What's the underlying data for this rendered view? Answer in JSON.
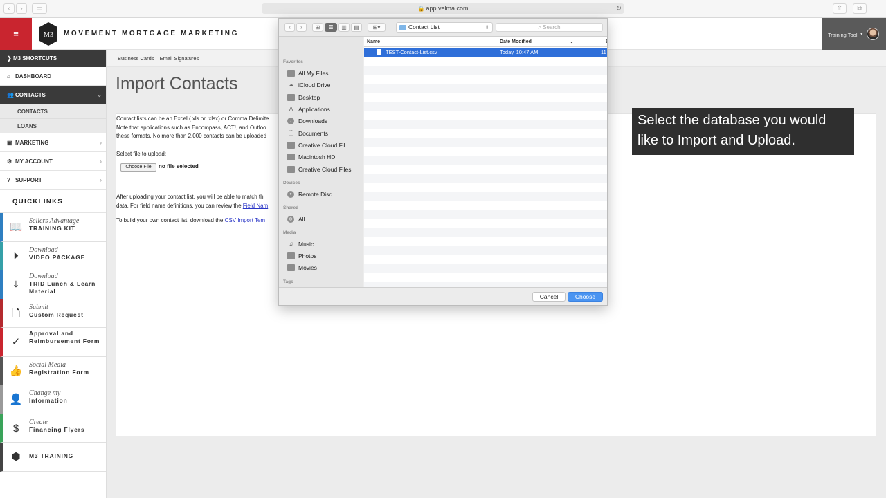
{
  "browser": {
    "url": "app.velma.com",
    "back": "‹",
    "forward": "›"
  },
  "header": {
    "brand": "MOVEMENT MORTGAGE MARKETING",
    "menu_icon": "hamburger-icon",
    "user_label": "Training Tool",
    "accent": "#c9252f"
  },
  "sidebar": {
    "shortcuts": "M3 SHORTCUTS",
    "nav": {
      "dashboard": "DASHBOARD",
      "contacts": "CONTACTS",
      "contacts_sub": "CONTACTS",
      "loans_sub": "LOANS",
      "marketing": "MARKETING",
      "my_account": "MY ACCOUNT",
      "support": "SUPPORT"
    },
    "quicklinks_title": "QUICKLINKS",
    "quicklinks": [
      {
        "italic": "Sellers Advantage",
        "bold": "TRAINING KIT",
        "color": "#2f7fc1",
        "icon": "book-icon"
      },
      {
        "italic": "Download",
        "bold": "VIDEO PACKAGE",
        "color": "#35a0a8",
        "icon": "play-icon"
      },
      {
        "italic": "Download",
        "bold": "TRID Lunch & Learn Material",
        "color": "#2f7fc1",
        "icon": "download-tray-icon"
      },
      {
        "italic": "Submit",
        "bold": "Custom Request",
        "color": "#b42a2f",
        "icon": "document-icon"
      },
      {
        "italic": "",
        "bold": "Approval and Reimbursement Form",
        "color": "#c9252f",
        "icon": "checkmark-icon"
      },
      {
        "italic": "Social Media",
        "bold": "Registration Form",
        "color": "#555555",
        "icon": "thumbs-up-icon"
      },
      {
        "italic": "Change my",
        "bold": "Information",
        "color": "#9a9a9a",
        "icon": "user-icon"
      },
      {
        "italic": "Create",
        "bold": "Financing Flyers",
        "color": "#3aa35a",
        "icon": "coin-stack-icon"
      },
      {
        "italic": "",
        "bold": "M3 TRAINING",
        "color": "#444444",
        "icon": "m3-logo-icon"
      }
    ]
  },
  "subnav": {
    "items": [
      "Business Cards",
      "Email Signatures"
    ]
  },
  "page": {
    "title": "Import Contacts",
    "para1_line1": "Contact lists can be an Excel (.xls or .xlsx) or Comma Delimite",
    "para1_line2": "Note that applications such as Encompass, ACT!, and Outloo",
    "para1_line3": "these formats. No more than 2,000 contacts can be uploaded",
    "select_label": "Select file to upload:",
    "choose_file": "Choose File",
    "no_file": "no file selected",
    "para2_line1": "After uploading your contact list, you will be able to match th",
    "para2_line2_prefix": "data. For field name definitions, you can review the ",
    "para2_link": "Field Nam",
    "para3_prefix": "To build your own contact list, download the ",
    "para3_link": "CSV Import Tem"
  },
  "callout": {
    "text": "Select the database you would like to Import and Upload."
  },
  "dialog": {
    "location": "Contact List",
    "search_placeholder": "Search",
    "sidebar": {
      "favorites_label": "Favorites",
      "favorites": [
        "All My Files",
        "iCloud Drive",
        "Desktop",
        "Applications",
        "Downloads",
        "Documents",
        "Creative Cloud Fil...",
        "Macintosh HD",
        "Creative Cloud Files"
      ],
      "devices_label": "Devices",
      "devices": [
        "Remote Disc"
      ],
      "shared_label": "Shared",
      "shared": [
        "All..."
      ],
      "media_label": "Media",
      "media": [
        "Music",
        "Photos",
        "Movies"
      ],
      "tags_label": "Tags"
    },
    "columns": {
      "name": "Name",
      "date": "Date Modified",
      "size": "S"
    },
    "files": [
      {
        "name": "TEST-Contact-List.csv",
        "date": "Today, 10:47 AM",
        "size": "11"
      }
    ],
    "cancel": "Cancel",
    "choose": "Choose",
    "selection_color": "#2f6fd9"
  }
}
